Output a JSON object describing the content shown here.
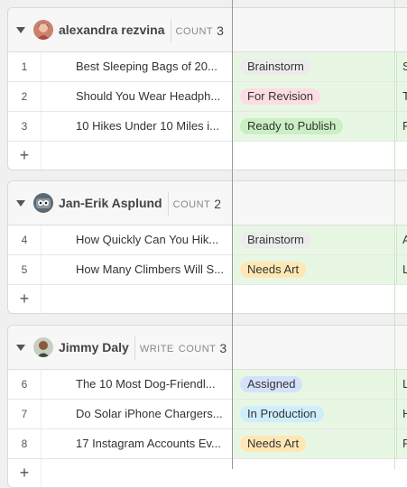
{
  "groups": [
    {
      "name": "alexandra rezvina",
      "avatar": "woman-avatar",
      "write_label": "",
      "count_label": "COUNT",
      "count": "3",
      "rows": [
        {
          "num": "1",
          "title": "Best Sleeping Bags of 20...",
          "status": "Brainstorm",
          "status_color": "#ececec",
          "next": "S"
        },
        {
          "num": "2",
          "title": "Should You Wear Headph...",
          "status": "For Revision",
          "status_color": "#fcdde4",
          "next": "T"
        },
        {
          "num": "3",
          "title": "10 Hikes Under 10 Miles i...",
          "status": "Ready to Publish",
          "status_color": "#c9efc3",
          "next": "F"
        }
      ],
      "add_label": "+"
    },
    {
      "name": "Jan-Erik Asplund",
      "avatar": "robot-avatar",
      "write_label": "",
      "count_label": "COUNT",
      "count": "2",
      "rows": [
        {
          "num": "4",
          "title": "How Quickly Can You Hik...",
          "status": "Brainstorm",
          "status_color": "#ececec",
          "next": "A"
        },
        {
          "num": "5",
          "title": "How Many Climbers Will S...",
          "status": "Needs Art",
          "status_color": "#ffe7b5",
          "next": "L"
        }
      ],
      "add_label": "+"
    },
    {
      "name": "Jimmy Daly",
      "avatar": "man-avatar",
      "write_label": "WRITE",
      "count_label": "COUNT",
      "count": "3",
      "rows": [
        {
          "num": "6",
          "title": "The 10 Most Dog-Friendl...",
          "status": "Assigned",
          "status_color": "#d5e1fb",
          "next": "L"
        },
        {
          "num": "7",
          "title": "Do Solar iPhone Chargers...",
          "status": "In Production",
          "status_color": "#cfeefc",
          "next": "H"
        },
        {
          "num": "8",
          "title": "17 Instagram Accounts Ev...",
          "status": "Needs Art",
          "status_color": "#ffe7b5",
          "next": "F"
        }
      ],
      "add_label": "+"
    }
  ]
}
